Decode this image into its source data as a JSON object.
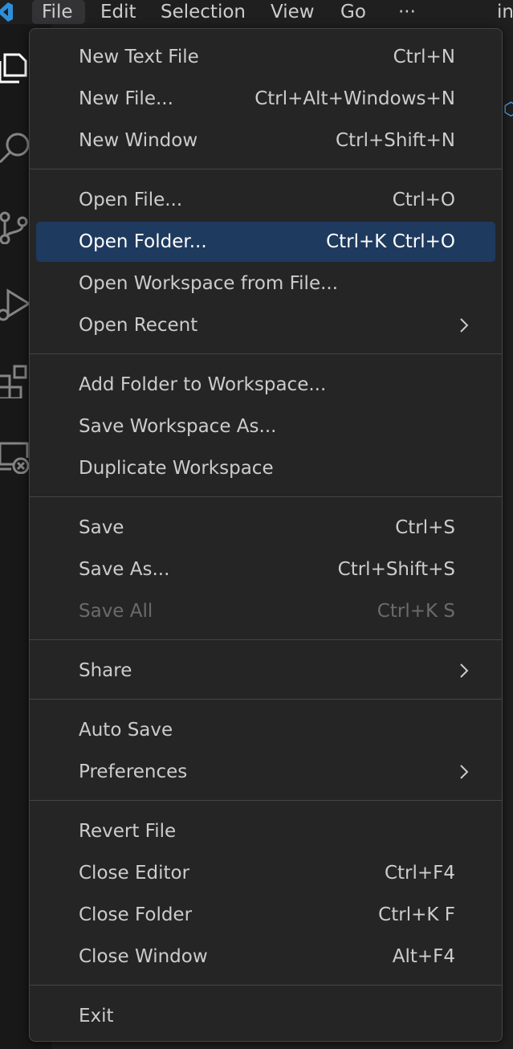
{
  "menubar": {
    "items": [
      {
        "label": "File"
      },
      {
        "label": "Edit"
      },
      {
        "label": "Selection"
      },
      {
        "label": "View"
      },
      {
        "label": "Go"
      },
      {
        "label": "···"
      }
    ],
    "title_partial": "in"
  },
  "file_menu": {
    "groups": [
      [
        {
          "label": "New Text File",
          "shortcut": "Ctrl+N"
        },
        {
          "label": "New File...",
          "shortcut": "Ctrl+Alt+Windows+N"
        },
        {
          "label": "New Window",
          "shortcut": "Ctrl+Shift+N"
        }
      ],
      [
        {
          "label": "Open File...",
          "shortcut": "Ctrl+O"
        },
        {
          "label": "Open Folder...",
          "shortcut": "Ctrl+K Ctrl+O",
          "selected": true
        },
        {
          "label": "Open Workspace from File...",
          "shortcut": ""
        },
        {
          "label": "Open Recent",
          "shortcut": "",
          "submenu": true
        }
      ],
      [
        {
          "label": "Add Folder to Workspace...",
          "shortcut": ""
        },
        {
          "label": "Save Workspace As...",
          "shortcut": ""
        },
        {
          "label": "Duplicate Workspace",
          "shortcut": ""
        }
      ],
      [
        {
          "label": "Save",
          "shortcut": "Ctrl+S"
        },
        {
          "label": "Save As...",
          "shortcut": "Ctrl+Shift+S"
        },
        {
          "label": "Save All",
          "shortcut": "Ctrl+K S",
          "disabled": true
        }
      ],
      [
        {
          "label": "Share",
          "shortcut": "",
          "submenu": true
        }
      ],
      [
        {
          "label": "Auto Save",
          "shortcut": ""
        },
        {
          "label": "Preferences",
          "shortcut": "",
          "submenu": true
        }
      ],
      [
        {
          "label": "Revert File",
          "shortcut": ""
        },
        {
          "label": "Close Editor",
          "shortcut": "Ctrl+F4"
        },
        {
          "label": "Close Folder",
          "shortcut": "Ctrl+K F"
        },
        {
          "label": "Close Window",
          "shortcut": "Alt+F4"
        }
      ],
      [
        {
          "label": "Exit",
          "shortcut": ""
        }
      ]
    ]
  },
  "activity_bar": {
    "icons": [
      "explorer-icon",
      "search-icon",
      "source-control-icon",
      "run-debug-icon",
      "extensions-icon",
      "remote-explorer-icon"
    ]
  },
  "colors": {
    "menu_bg": "#252526",
    "selected_bg": "#1f3a5f",
    "text": "#cccccc",
    "disabled_text": "#6b6b6b",
    "accent": "#4daafc"
  }
}
